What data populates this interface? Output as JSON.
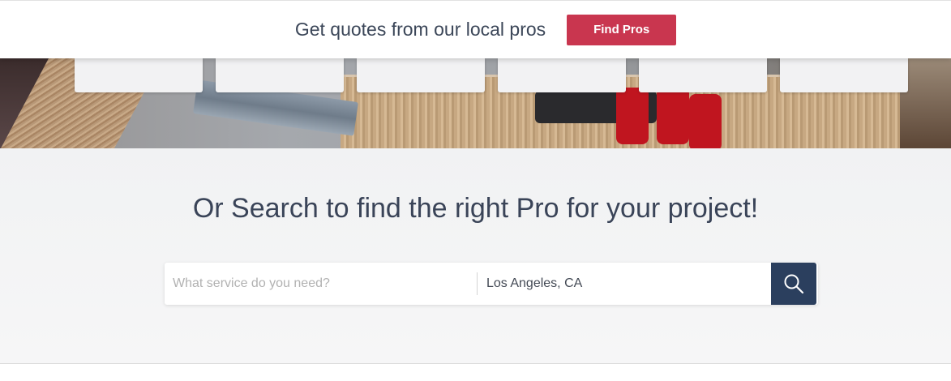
{
  "topbar": {
    "text": "Get quotes from our local pros",
    "button_label": "Find Pros",
    "button_color": "#c9364f"
  },
  "search": {
    "title": "Or Search to find the right Pro for your project!",
    "service_placeholder": "What service do you need?",
    "location_value": "Los Angeles, CA",
    "button_icon": "search-icon",
    "button_color": "#2b3f5e"
  }
}
